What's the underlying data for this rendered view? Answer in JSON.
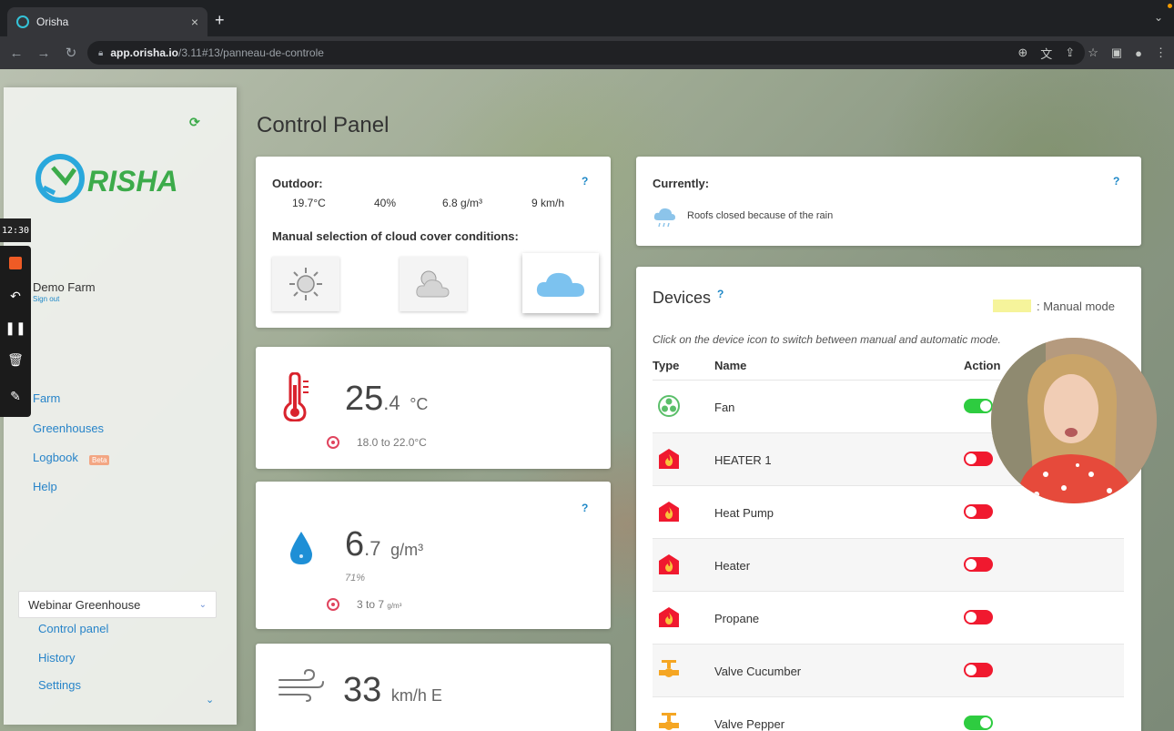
{
  "browser": {
    "tab_title": "Orisha",
    "tab_close": "×",
    "new_tab": "+",
    "url_domain": "app.orisha.io",
    "url_path": "/3.11#13/panneau-de-controle"
  },
  "sidebar": {
    "logo_text": "RISHA",
    "farm_name": "Demo Farm",
    "sign_out": "Sign out",
    "links": [
      "Farm",
      "Greenhouses",
      "Logbook",
      "Help"
    ],
    "beta_badge": "Beta",
    "greenhouse_select": "Webinar Greenhouse",
    "sub_links": [
      "Control panel",
      "History",
      "Settings"
    ]
  },
  "recorder": {
    "time": "12:30"
  },
  "main": {
    "title": "Control Panel",
    "outdoor": {
      "label": "Outdoor:",
      "temp": "19.7°C",
      "humidity": "40%",
      "abs_humidity": "6.8 g/m³",
      "wind": "9 km/h",
      "cloud_label": "Manual selection of cloud cover conditions:",
      "selected_cloud": "cloudy"
    },
    "temperature": {
      "int": "25",
      "dec": ".4",
      "unit": "°C",
      "target": "18.0 to 22.0°C"
    },
    "humidity": {
      "int": "6",
      "dec": ".7",
      "unit": "g/m³",
      "relative": "71%",
      "target": "3 to 7",
      "target_unit": "g/m³"
    },
    "wind": {
      "value": "33",
      "unit": "km/h E"
    },
    "currently": {
      "label": "Currently:",
      "text": "Roofs closed because of the rain"
    },
    "devices": {
      "title": "Devices",
      "manual_mode": ": Manual mode",
      "hint": "Click on the device icon to switch between manual and automatic mode.",
      "col_type": "Type",
      "col_name": "Name",
      "col_action": "Action",
      "rows": [
        {
          "name": "Fan",
          "icon": "fan-icon",
          "on": true
        },
        {
          "name": "HEATER 1",
          "icon": "flame-icon",
          "on": false
        },
        {
          "name": "Heat Pump",
          "icon": "flame-icon",
          "on": false
        },
        {
          "name": "Heater",
          "icon": "flame-icon",
          "on": false
        },
        {
          "name": "Propane",
          "icon": "flame-icon",
          "on": false
        },
        {
          "name": "Valve Cucumber",
          "icon": "valve-icon",
          "on": false
        },
        {
          "name": "Valve Pepper",
          "icon": "valve-icon",
          "on": true
        }
      ]
    }
  },
  "colors": {
    "accent_blue": "#2784c9",
    "toggle_on": "#2ecc40",
    "toggle_off": "#f0192f",
    "heater_red": "#f0192f",
    "valve_orange": "#f5a623"
  }
}
